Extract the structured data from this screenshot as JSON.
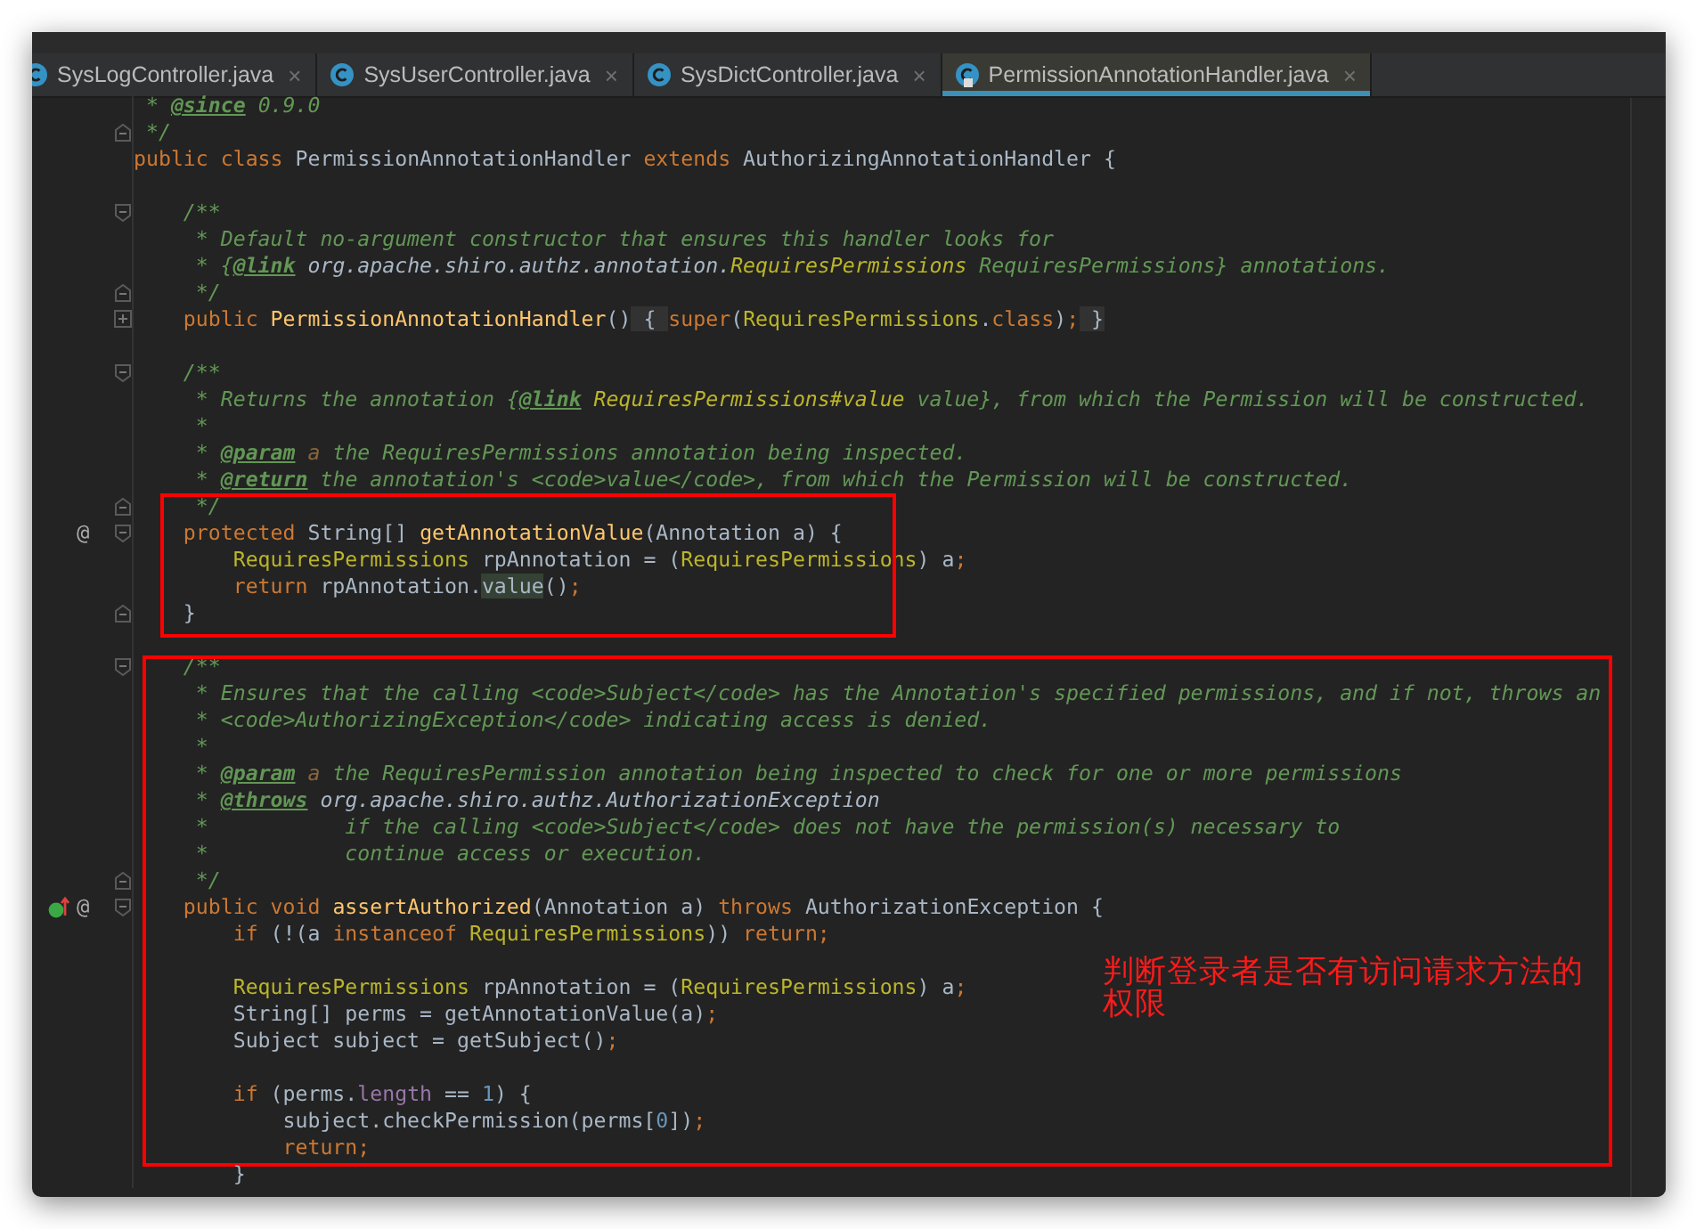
{
  "tabs": [
    {
      "label": "SysLogController.java",
      "selected": false,
      "locked": false
    },
    {
      "label": "SysUserController.java",
      "selected": false,
      "locked": false
    },
    {
      "label": "SysDictController.java",
      "selected": false,
      "locked": false
    },
    {
      "label": "PermissionAnnotationHandler.java",
      "selected": true,
      "locked": true
    }
  ],
  "tab_close": "×",
  "editor": {
    "sections": [
      {
        "kind": "plain",
        "lines": [
          {
            "segs": [
              {
                "kind": "comment",
                "text": " * "
              },
              {
                "kind": "doctag",
                "text": "@since"
              },
              {
                "kind": "comment",
                "text": " 0.9.0"
              }
            ]
          },
          {
            "gutter": [
              {
                "kind": "fold_close"
              }
            ],
            "segs": [
              {
                "kind": "comment",
                "text": " */"
              }
            ]
          },
          {
            "segs": [
              {
                "kind": "kw",
                "text": "public class "
              },
              {
                "kind": "plain",
                "text": "PermissionAnnotationHandler "
              },
              {
                "kind": "kw",
                "text": "extends "
              },
              {
                "kind": "plain",
                "text": "AuthorizingAnnotationHandler {"
              }
            ]
          },
          {
            "kind": "blank"
          },
          {
            "gutter": [
              {
                "kind": "fold_open"
              }
            ],
            "segs": [
              {
                "kind": "comment",
                "text": "    /**"
              }
            ]
          },
          {
            "segs": [
              {
                "kind": "comment",
                "text": "     * Default no-argument constructor that ensures this handler looks for"
              }
            ]
          },
          {
            "segs": [
              {
                "kind": "comment",
                "text": "     * {"
              },
              {
                "kind": "doctag",
                "text": "@link"
              },
              {
                "kind": "docref",
                "text": " org.apache.shiro.authz.annotation."
              },
              {
                "kind": "doctype",
                "text": "RequiresPermissions"
              },
              {
                "kind": "comment",
                "text": " RequiresPermissions} annotations."
              }
            ]
          },
          {
            "gutter": [
              {
                "kind": "fold_close"
              }
            ],
            "segs": [
              {
                "kind": "comment",
                "text": "     */"
              }
            ]
          },
          {
            "gutter": [
              {
                "kind": "fold_collapsed"
              }
            ],
            "segs": [
              {
                "kind": "kw",
                "text": "    public "
              },
              {
                "kind": "method",
                "text": "PermissionAnnotationHandler"
              },
              {
                "kind": "plain",
                "text": "()"
              },
              {
                "kind": "folded",
                "text": " { "
              },
              {
                "kind": "kw",
                "text": "super"
              },
              {
                "kind": "plain",
                "text": "("
              },
              {
                "kind": "type",
                "text": "RequiresPermissions"
              },
              {
                "kind": "plain",
                "text": "."
              },
              {
                "kind": "kw",
                "text": "class"
              },
              {
                "kind": "plain",
                "text": ")"
              },
              {
                "kind": "kw",
                "text": ";"
              },
              {
                "kind": "folded",
                "text": " }"
              }
            ]
          },
          {
            "kind": "blank"
          },
          {
            "gutter": [
              {
                "kind": "fold_open"
              }
            ],
            "segs": [
              {
                "kind": "comment",
                "text": "    /**"
              }
            ]
          },
          {
            "segs": [
              {
                "kind": "comment",
                "text": "     * Returns the annotation {"
              },
              {
                "kind": "doctag",
                "text": "@link"
              },
              {
                "kind": "doctype",
                "text": " RequiresPermissions#value"
              },
              {
                "kind": "comment",
                "text": " value}, from which the Permission will be constructed."
              }
            ]
          },
          {
            "segs": [
              {
                "kind": "comment",
                "text": "     *"
              }
            ]
          },
          {
            "segs": [
              {
                "kind": "comment",
                "text": "     * "
              },
              {
                "kind": "doctag",
                "text": "@param"
              },
              {
                "kind": "docparam",
                "text": " a"
              },
              {
                "kind": "comment",
                "text": " the RequiresPermissions annotation being inspected."
              }
            ]
          },
          {
            "segs": [
              {
                "kind": "comment",
                "text": "     * "
              },
              {
                "kind": "doctag",
                "text": "@return"
              },
              {
                "kind": "comment",
                "text": " the annotation's <code>value</code>, from which the Permission will be constructed."
              }
            ]
          }
        ]
      },
      {
        "kind": "box",
        "lines": [
          {
            "gutter": [
              {
                "kind": "fold_close"
              }
            ],
            "segs": [
              {
                "kind": "comment",
                "text": "     */"
              }
            ]
          },
          {
            "gutter": [
              {
                "kind": "implements",
                "text": "@"
              },
              {
                "kind": "fold_open"
              }
            ],
            "segs": [
              {
                "kind": "kw",
                "text": "    protected "
              },
              {
                "kind": "plain",
                "text": "String[] "
              },
              {
                "kind": "method",
                "text": "getAnnotationValue"
              },
              {
                "kind": "plain",
                "text": "(Annotation a) {"
              }
            ]
          },
          {
            "segs": [
              {
                "kind": "type",
                "text": "        RequiresPermissions"
              },
              {
                "kind": "plain",
                "text": " rpAnnotation = ("
              },
              {
                "kind": "type",
                "text": "RequiresPermissions"
              },
              {
                "kind": "plain",
                "text": ") a"
              },
              {
                "kind": "kw",
                "text": ";"
              }
            ]
          },
          {
            "segs": [
              {
                "kind": "kw",
                "text": "        return "
              },
              {
                "kind": "plain",
                "text": "rpAnnotation."
              },
              {
                "kind": "usage",
                "text": "value"
              },
              {
                "kind": "plain",
                "text": "()"
              },
              {
                "kind": "kw",
                "text": ";"
              }
            ]
          },
          {
            "gutter": [
              {
                "kind": "fold_close"
              }
            ],
            "segs": [
              {
                "kind": "plain",
                "text": "    }"
              }
            ]
          }
        ]
      },
      {
        "kind": "plain",
        "lines": [
          {
            "kind": "blank"
          }
        ]
      },
      {
        "kind": "box",
        "note": "判断登录者是否有访问请求方法的权限",
        "lines": [
          {
            "gutter": [
              {
                "kind": "fold_open"
              }
            ],
            "segs": [
              {
                "kind": "comment",
                "text": "    /**"
              }
            ]
          },
          {
            "segs": [
              {
                "kind": "comment",
                "text": "     * Ensures that the calling <code>Subject</code> has the Annotation's specified permissions, and if not, throws an"
              }
            ]
          },
          {
            "segs": [
              {
                "kind": "comment",
                "text": "     * <code>AuthorizingException</code> indicating access is denied."
              }
            ]
          },
          {
            "segs": [
              {
                "kind": "comment",
                "text": "     *"
              }
            ]
          },
          {
            "segs": [
              {
                "kind": "comment",
                "text": "     * "
              },
              {
                "kind": "doctag",
                "text": "@param"
              },
              {
                "kind": "docparam",
                "text": " a"
              },
              {
                "kind": "comment",
                "text": " the RequiresPermission annotation being inspected to check for one or more permissions"
              }
            ]
          },
          {
            "segs": [
              {
                "kind": "comment",
                "text": "     * "
              },
              {
                "kind": "doctag",
                "text": "@throws"
              },
              {
                "kind": "docref",
                "text": " org.apache.shiro.authz.AuthorizationException"
              }
            ]
          },
          {
            "segs": [
              {
                "kind": "comment",
                "text": "     *           if the calling <code>Subject</code> does not have the permission(s) necessary to"
              }
            ]
          },
          {
            "segs": [
              {
                "kind": "comment",
                "text": "     *           continue access or execution."
              }
            ]
          },
          {
            "gutter": [
              {
                "kind": "fold_close"
              }
            ],
            "segs": [
              {
                "kind": "comment",
                "text": "     */"
              }
            ]
          },
          {
            "gutter": [
              {
                "kind": "override"
              },
              {
                "kind": "implements",
                "text": "@"
              },
              {
                "kind": "fold_open"
              }
            ],
            "segs": [
              {
                "kind": "kw",
                "text": "    public void "
              },
              {
                "kind": "method",
                "text": "assertAuthorized"
              },
              {
                "kind": "plain",
                "text": "(Annotation a) "
              },
              {
                "kind": "kw",
                "text": "throws "
              },
              {
                "kind": "plain",
                "text": "AuthorizationException {"
              }
            ]
          },
          {
            "segs": [
              {
                "kind": "kw",
                "text": "        if "
              },
              {
                "kind": "plain",
                "text": "(!(a "
              },
              {
                "kind": "kw",
                "text": "instanceof "
              },
              {
                "kind": "type",
                "text": "RequiresPermissions"
              },
              {
                "kind": "plain",
                "text": ")) "
              },
              {
                "kind": "kw",
                "text": "return;"
              }
            ]
          },
          {
            "kind": "blank"
          },
          {
            "segs": [
              {
                "kind": "type",
                "text": "        RequiresPermissions"
              },
              {
                "kind": "plain",
                "text": " rpAnnotation = ("
              },
              {
                "kind": "type",
                "text": "RequiresPermissions"
              },
              {
                "kind": "plain",
                "text": ") a"
              },
              {
                "kind": "kw",
                "text": ";"
              }
            ]
          },
          {
            "segs": [
              {
                "kind": "plain",
                "text": "        String[] perms = getAnnotationValue(a)"
              },
              {
                "kind": "kw",
                "text": ";"
              }
            ]
          },
          {
            "segs": [
              {
                "kind": "plain",
                "text": "        Subject subject = getSubject()"
              },
              {
                "kind": "kw",
                "text": ";"
              }
            ]
          },
          {
            "kind": "blank"
          },
          {
            "segs": [
              {
                "kind": "kw",
                "text": "        if "
              },
              {
                "kind": "plain",
                "text": "(perms."
              },
              {
                "kind": "field",
                "text": "length"
              },
              {
                "kind": "plain",
                "text": " == "
              },
              {
                "kind": "number",
                "text": "1"
              },
              {
                "kind": "plain",
                "text": ") {"
              }
            ]
          },
          {
            "segs": [
              {
                "kind": "plain",
                "text": "            subject.checkPermission(perms["
              },
              {
                "kind": "number",
                "text": "0"
              },
              {
                "kind": "plain",
                "text": "])"
              },
              {
                "kind": "kw",
                "text": ";"
              }
            ]
          },
          {
            "segs": [
              {
                "kind": "kw",
                "text": "            return;"
              }
            ]
          }
        ]
      },
      {
        "kind": "plain",
        "lines": [
          {
            "segs": [
              {
                "kind": "plain",
                "text": "        }"
              }
            ]
          }
        ]
      }
    ]
  }
}
